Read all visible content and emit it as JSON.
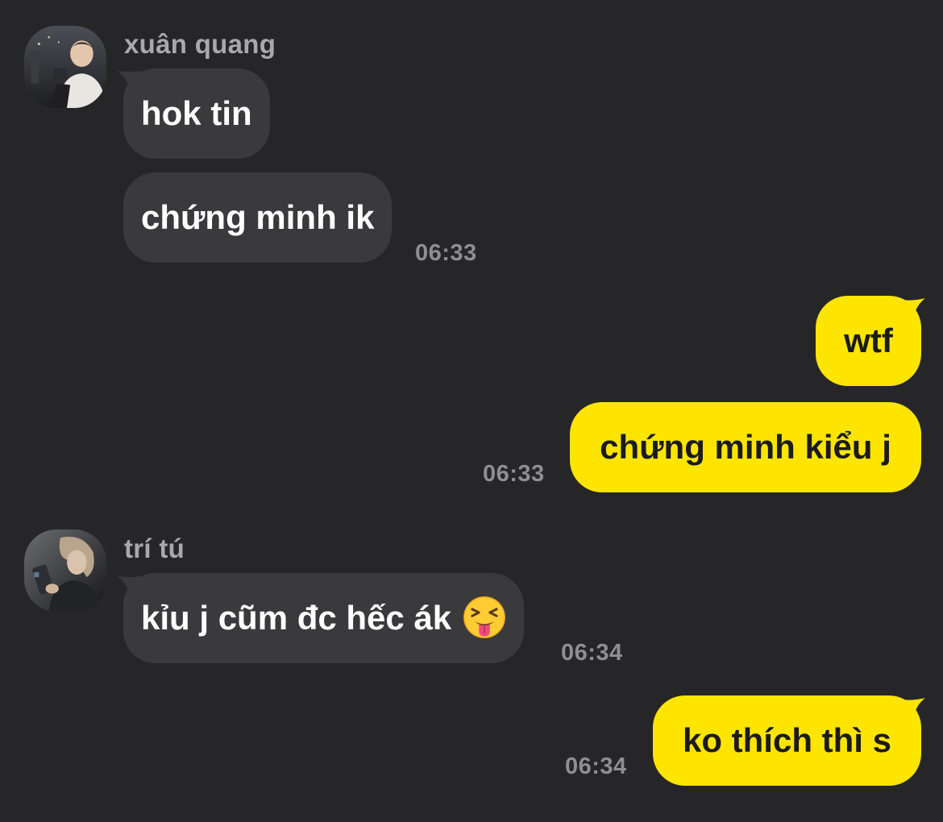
{
  "messages": {
    "group1": {
      "sender": "xuân quang",
      "bubbles": [
        "hok tin",
        "chứng minh ik"
      ],
      "time": "06:33"
    },
    "group2": {
      "bubbles": [
        "wtf",
        "chứng minh kiểu j"
      ],
      "time": "06:33"
    },
    "group3": {
      "sender": "trí tú",
      "bubbles": [
        "kỉu j cũm đc hếc ák"
      ],
      "emoji": "squinting-face-with-tongue",
      "time": "06:34"
    },
    "group4": {
      "bubbles": [
        "ko thích thì s"
      ],
      "time": "06:34"
    }
  },
  "colors": {
    "background": "#262628",
    "incoming_bubble": "#3a3a3d",
    "outgoing_bubble": "#fee500",
    "timestamp": "#8e8e93",
    "sender_name": "#a9a9ad"
  }
}
